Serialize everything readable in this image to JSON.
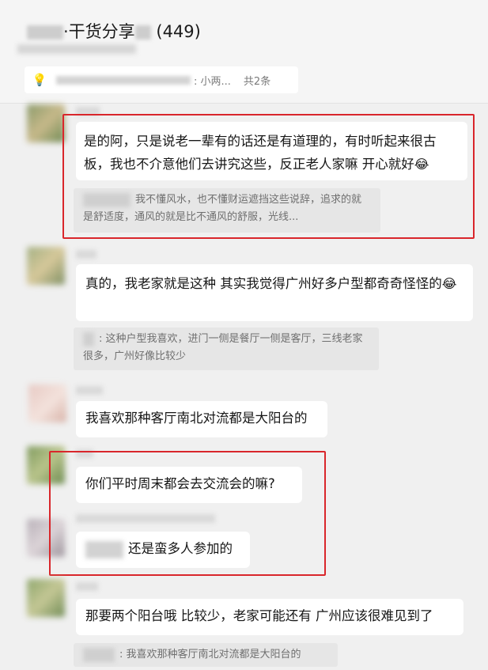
{
  "header": {
    "title_suffix": "·干货分享",
    "member_count": "(449)"
  },
  "pinned": {
    "bulb_icon": "lightbulb-icon",
    "preview": ": 小两...",
    "count": "共2条"
  },
  "messages": [
    {
      "text": "是的阿，只是说老一辈有的话还是有道理的，有时听起来很古板，我也不介意他们去讲究这些，反正老人家嘛 开心就好",
      "emoji": "😂",
      "quote": "我不懂风水，也不懂财运遮挡这些说辞，追求的就是舒适度，通风的就是比不通风的舒服，光线..."
    },
    {
      "text": "真的，我老家就是这种 其实我觉得广州好多户型都奇奇怪怪的",
      "emoji": "😂",
      "quote": ": 这种户型我喜欢，进门一侧是餐厅一侧是客厅，三线老家很多，广州好像比较少"
    },
    {
      "text": "我喜欢那种客厅南北对流都是大阳台的"
    },
    {
      "text": "你们平时周末都会去交流会的嘛?"
    },
    {
      "text": "还是蛮多人参加的"
    },
    {
      "text": "那要两个阳台哦 比较少，老家可能还有 广州应该很难见到了",
      "quote": ": 我喜欢那种客厅南北对流都是大阳台的"
    }
  ],
  "colors": {
    "highlight_border": "#d9262b",
    "bubble_bg": "#ffffff",
    "page_bg": "#f0f0f0"
  }
}
